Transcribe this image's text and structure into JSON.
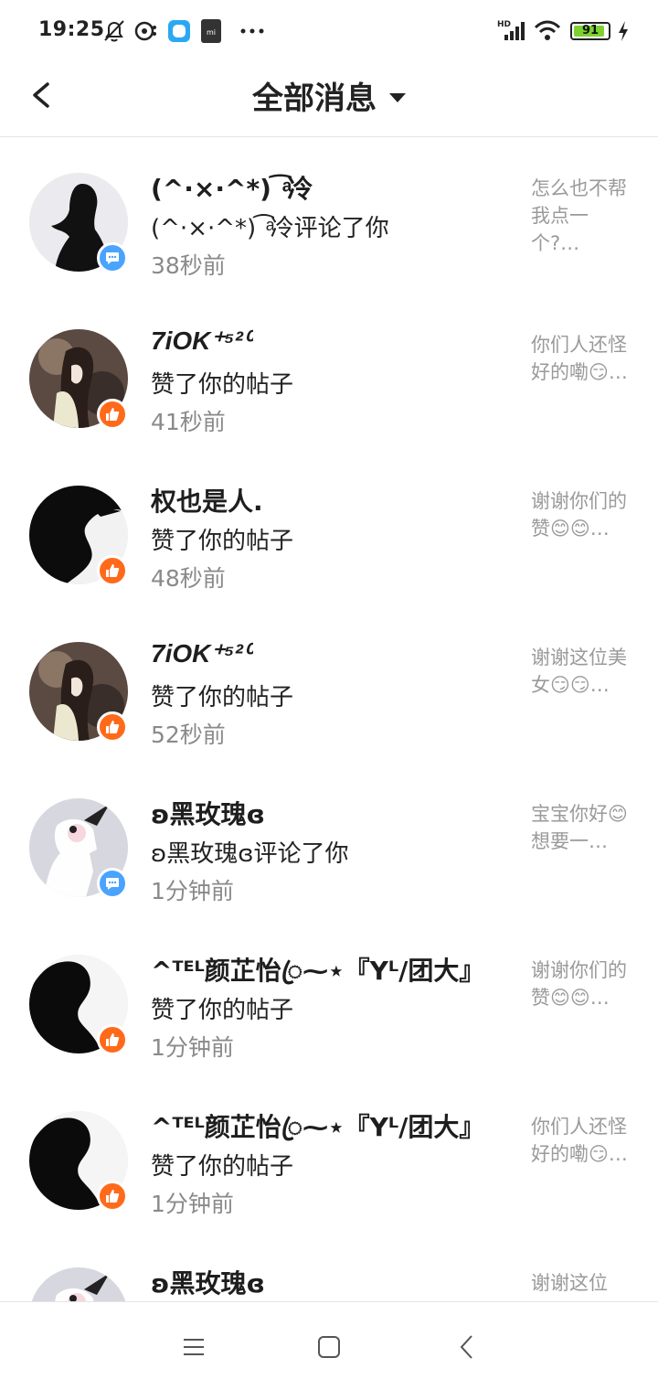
{
  "status": {
    "time": "19:25",
    "battery": "91",
    "battery_level": 0.91,
    "icons": [
      "bell-off-icon",
      "music-icon",
      "app-icon",
      "mi-icon",
      "more-dots-icon",
      "hd-signal-icon",
      "wifi-icon",
      "charging-icon"
    ]
  },
  "header": {
    "title": "全部消息",
    "back_icon": "chevron-left-icon",
    "dropdown_icon": "caret-down-icon"
  },
  "messages": [
    {
      "name": "(^·×·^*) ͡ ͣ冷",
      "action": "(^·×·^*) ͡ ͣ冷评论了你",
      "time": "38秒前",
      "preview": "怎么也不帮我点一个?…",
      "type": "comment",
      "italic": false
    },
    {
      "name": "7iOK⁺⁵²⁰",
      "action": "赞了你的帖子",
      "time": "41秒前",
      "preview": "你们人还怪好的嘞😏…",
      "type": "like",
      "italic": true
    },
    {
      "name": "权也是人.",
      "action": "赞了你的帖子",
      "time": "48秒前",
      "preview": "谢谢你们的赞😊😊…",
      "type": "like",
      "italic": false
    },
    {
      "name": "7iOK⁺⁵²⁰",
      "action": "赞了你的帖子",
      "time": "52秒前",
      "preview": "谢谢这位美女😏😏…",
      "type": "like",
      "italic": true
    },
    {
      "name": "ʚ黑玫瑰ɞ",
      "action": "ʚ黑玫瑰ɞ评论了你",
      "time": "1分钟前",
      "preview": "宝宝你好😊想要一…",
      "type": "comment",
      "italic": false
    },
    {
      "name": "^ᵀᴱᴸ颜芷怡ꦿ⁓⋆『Yᴸ/团大』",
      "action": "赞了你的帖子",
      "time": "1分钟前",
      "preview": "谢谢你们的赞😊😊…",
      "type": "like",
      "italic": false
    },
    {
      "name": "^ᵀᴱᴸ颜芷怡ꦿ⁓⋆『Yᴸ/团大』",
      "action": "赞了你的帖子",
      "time": "1分钟前",
      "preview": "你们人还怪好的嘞😏…",
      "type": "like",
      "italic": false
    },
    {
      "name": "ʚ黑玫瑰ɞ",
      "action": "",
      "time": "",
      "preview": "谢谢这位",
      "type": "comment",
      "italic": false
    }
  ],
  "colors": {
    "like_badge": "#ff6a1a",
    "comment_badge": "#4aa3ff",
    "time_text": "#8a8a8a",
    "preview_text": "#9a9a9a",
    "battery_fill": "#7dd12f"
  },
  "nav": {
    "menu_icon": "menu-icon",
    "home_icon": "home-square-icon",
    "back_icon": "back-triangle-icon"
  }
}
